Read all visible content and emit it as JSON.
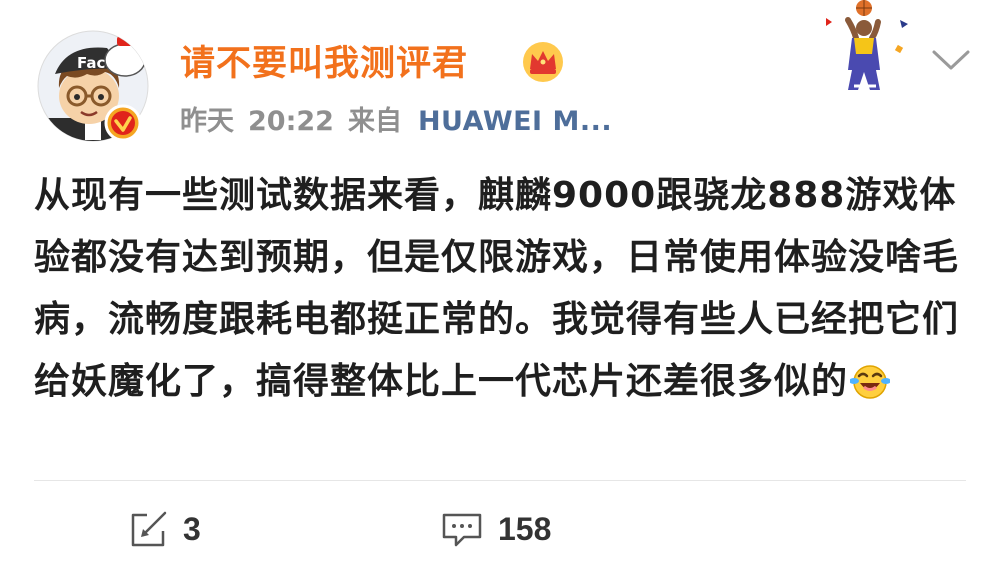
{
  "user": {
    "name": "请不要叫我测评君",
    "avatar_icon": "cartoon-avatar-icon",
    "verified_icon": "verified-badge-icon",
    "crown_icon": "crown-icon",
    "avatar_text": "Fac"
  },
  "meta": {
    "date": "昨天",
    "time": "20:22",
    "from_label": "来自",
    "device": "HUAWEI M..."
  },
  "post": {
    "text": "从现有一些测试数据来看，麒麟9000跟骁龙888游戏体验都没有达到预期，但是仅限游戏，日常使用体验没啥毛病，流畅度跟耗电都挺正常的。我觉得有些人已经把它们给妖魔化了，搞得整体比上一代芯片还差很多似的",
    "emoji_icon": "laugh-cry-emoji-icon"
  },
  "actions": {
    "repost_icon": "repost-icon",
    "repost_count": "3",
    "comment_icon": "comment-icon",
    "comment_count": "158"
  },
  "decoration_icon": "basketball-player-icon",
  "menu_icon": "chevron-down-icon",
  "colors": {
    "username": "#f2711c",
    "device_link": "#4e6e9a",
    "meta_gray": "#8f8f8f",
    "badge_orange": "#f5a623",
    "badge_red": "#e0241b"
  }
}
